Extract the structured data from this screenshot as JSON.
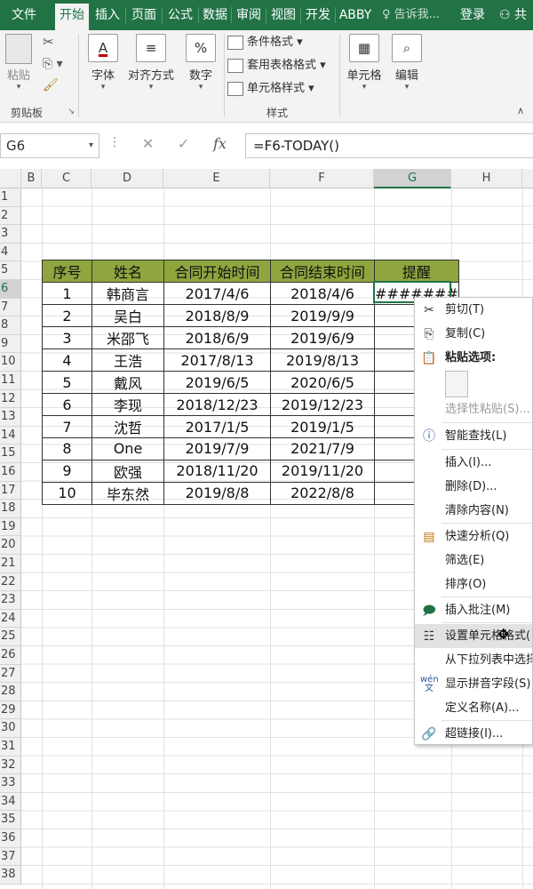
{
  "ribbon_tabs": [
    "文件",
    "开始",
    "插入",
    "页面",
    "公式",
    "数据",
    "审阅",
    "视图",
    "开发",
    "ABBY"
  ],
  "tell_me": "告诉我...",
  "login": "登录",
  "share": "共",
  "clipboard": {
    "paste": "粘贴",
    "group": "剪贴板"
  },
  "font": {
    "label": "字体"
  },
  "align": {
    "label": "对齐方式"
  },
  "number": {
    "label": "数字"
  },
  "styles": {
    "cond": "条件格式",
    "table": "套用表格格式",
    "cell": "单元格样式",
    "group": "样式"
  },
  "cells": {
    "label": "单元格"
  },
  "edit": {
    "label": "编辑"
  },
  "formula_bar": {
    "name_box": "G6",
    "formula": "=F6-TODAY()"
  },
  "columns": [
    "B",
    "C",
    "D",
    "E",
    "F",
    "G",
    "H"
  ],
  "rows": [
    "1",
    "2",
    "3",
    "4",
    "5",
    "6",
    "7",
    "8",
    "9",
    "10",
    "11",
    "12",
    "13",
    "14",
    "15",
    "16",
    "17",
    "18",
    "19",
    "20",
    "21",
    "22",
    "23",
    "24",
    "25",
    "26",
    "27",
    "28",
    "29",
    "30",
    "31",
    "32",
    "33",
    "34",
    "35",
    "36",
    "37",
    "38"
  ],
  "table": {
    "headers": [
      "序号",
      "姓名",
      "合同开始时间",
      "合同结束时间",
      "提醒"
    ],
    "rows": [
      [
        "1",
        "韩商言",
        "2017/4/6",
        "2018/4/6",
        "#######"
      ],
      [
        "2",
        "吴白",
        "2018/8/9",
        "2019/9/9",
        ""
      ],
      [
        "3",
        "米邵飞",
        "2018/6/9",
        "2019/6/9",
        ""
      ],
      [
        "4",
        "王浩",
        "2017/8/13",
        "2019/8/13",
        ""
      ],
      [
        "5",
        "戴风",
        "2019/6/5",
        "2020/6/5",
        ""
      ],
      [
        "6",
        "李现",
        "2018/12/23",
        "2019/12/23",
        ""
      ],
      [
        "7",
        "沈哲",
        "2017/1/5",
        "2019/1/5",
        ""
      ],
      [
        "8",
        "One",
        "2019/7/9",
        "2021/7/9",
        ""
      ],
      [
        "9",
        "欧强",
        "2018/11/20",
        "2019/11/20",
        ""
      ],
      [
        "10",
        "毕东然",
        "2019/8/8",
        "2022/8/8",
        ""
      ]
    ]
  },
  "context_menu": {
    "cut": "剪切(T)",
    "copy": "复制(C)",
    "paste_options": "粘贴选项:",
    "paste_special": "选择性粘贴(S)...",
    "smart_lookup": "智能查找(L)",
    "insert": "插入(I)...",
    "delete": "删除(D)...",
    "clear": "清除内容(N)",
    "quick_analysis": "快速分析(Q)",
    "filter": "筛选(E)",
    "sort": "排序(O)",
    "insert_comment": "插入批注(M)",
    "format_cells": "设置单元格格式(",
    "pick_list": "从下拉列表中选择",
    "phonetic": "显示拼音字段(S)",
    "define_name": "定义名称(A)...",
    "hyperlink": "超链接(I)..."
  },
  "colors": {
    "excel_green": "#217346",
    "header_fill": "#8fa53e"
  }
}
